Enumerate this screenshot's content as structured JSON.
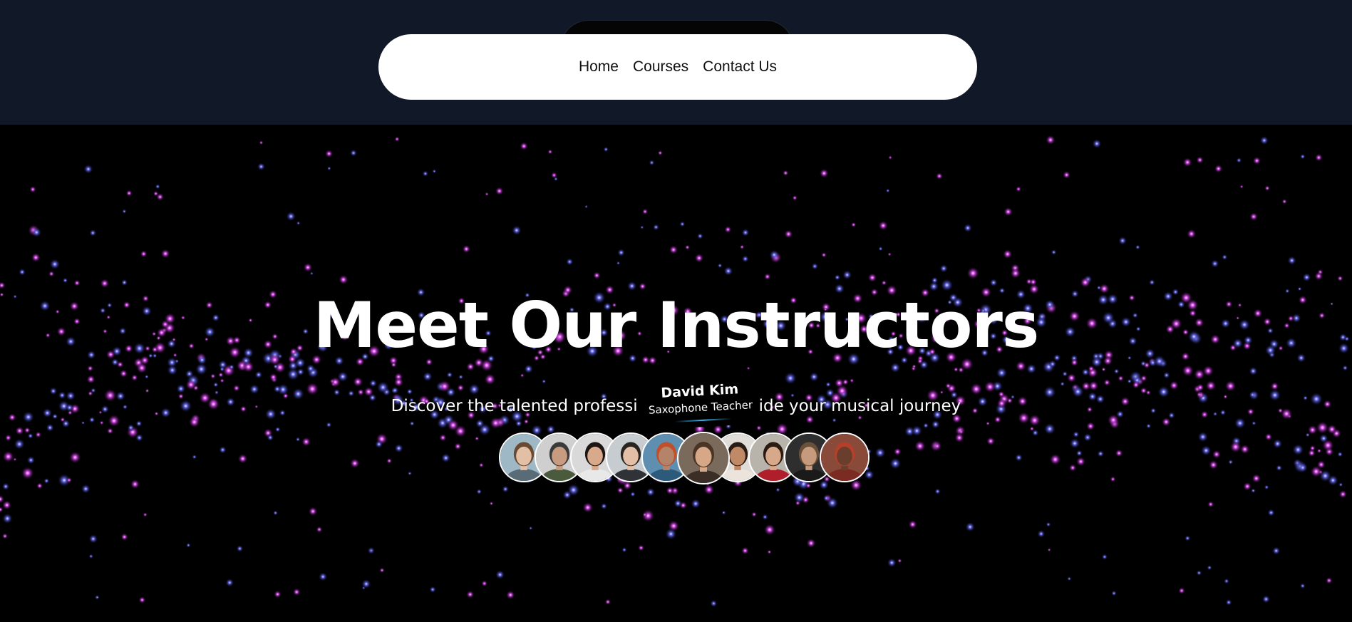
{
  "nav": {
    "links": [
      "Home",
      "Courses",
      "Contact Us"
    ]
  },
  "hero": {
    "title": "Meet Our Instructors",
    "subtitle": "Discover the talented professi",
    "subtitle_tail": "ide your musical journey"
  },
  "tooltip": {
    "name": "David Kim",
    "role": "Saxophone Teacher"
  },
  "instructors": [
    {
      "bg": "#9fb8c6",
      "skin": "#e3c0a5",
      "hair": "#6b4a32",
      "shirt": "#5a6b78"
    },
    {
      "bg": "#cfcfcf",
      "skin": "#c89c80",
      "hair": "#3a3a3a",
      "shirt": "#4a5a3c"
    },
    {
      "bg": "#d9d9d9",
      "skin": "#d8a98a",
      "hair": "#1e1612",
      "shirt": "#e8e8e8"
    },
    {
      "bg": "#c6ccd0",
      "skin": "#e2bfa6",
      "hair": "#2a2420",
      "shirt": "#2f3338"
    },
    {
      "bg": "#5f8fb0",
      "skin": "#b5826a",
      "hair": "#c0502a",
      "shirt": "#2b5a7a"
    },
    {
      "bg": "#7a6a5c",
      "skin": "#d6a888",
      "hair": "#4a3424",
      "shirt": "#3a2e26"
    },
    {
      "bg": "#e0ddd8",
      "skin": "#c08a66",
      "hair": "#2a1c14",
      "shirt": "#ece4dc"
    },
    {
      "bg": "#b8b3ab",
      "skin": "#d8a88a",
      "hair": "#2a1a12",
      "shirt": "#b01e2c"
    },
    {
      "bg": "#2e2e2e",
      "skin": "#c69a7c",
      "hair": "#6a5038",
      "shirt": "#1a1a1a"
    },
    {
      "bg": "#8a4a3a",
      "skin": "#6a3e2c",
      "hair": "#b2402a",
      "shirt": "#7a2c22"
    }
  ],
  "active_index": 5,
  "colors": {
    "top_band": "#111827",
    "particle_pink": "#d946ef",
    "particle_blue": "#6366f1"
  }
}
